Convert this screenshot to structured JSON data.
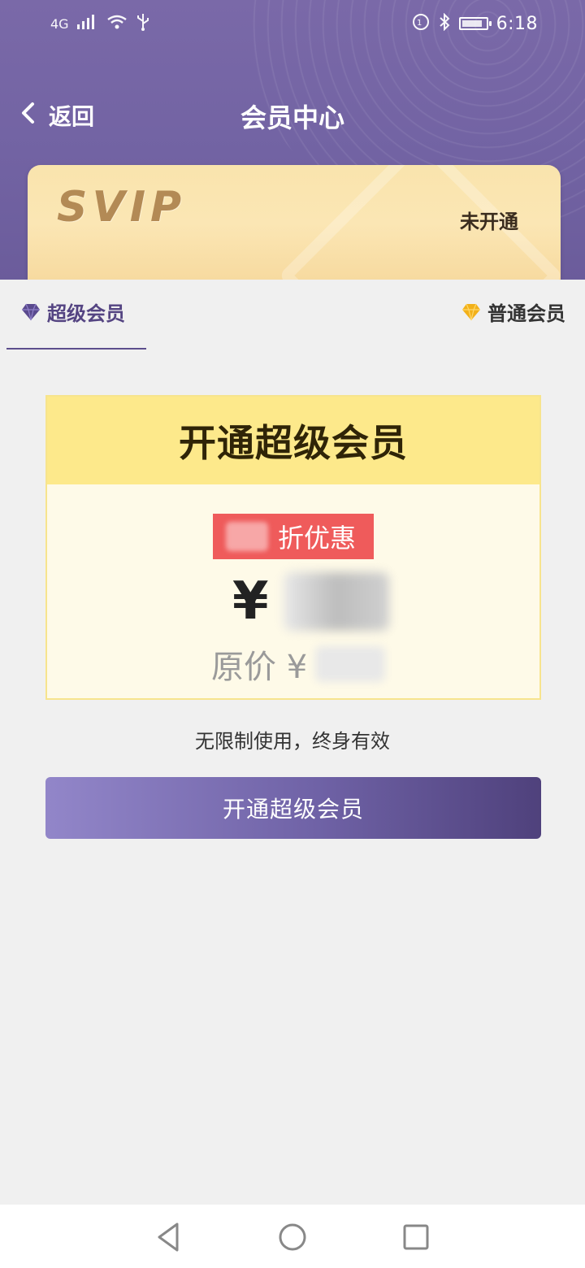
{
  "status_bar": {
    "network": "4G",
    "time": "6:18"
  },
  "navbar": {
    "back_label": "返回",
    "title": "会员中心"
  },
  "member_card": {
    "brand": "SVIP",
    "status": "未开通"
  },
  "tabs": [
    {
      "label": "超级会员",
      "active": true
    },
    {
      "label": "普通会员",
      "active": false
    }
  ],
  "offer": {
    "heading": "开通超级会员",
    "discount_suffix": "折优惠",
    "currency": "¥",
    "original_prefix": "原价 ¥"
  },
  "note": "无限制使用，终身有效",
  "cta_label": "开通超级会员",
  "colors": {
    "header_bg": "#7263a3",
    "card_gold": "#f9e4ad",
    "discount_red": "#ef5b5b",
    "cta_gradient_start": "#9286c9",
    "cta_gradient_end": "#4f417c"
  },
  "icons": {
    "back": "chevron-left-icon",
    "svip_tab": "diamond-icon-purple",
    "vip_tab": "diamond-icon-gold"
  }
}
